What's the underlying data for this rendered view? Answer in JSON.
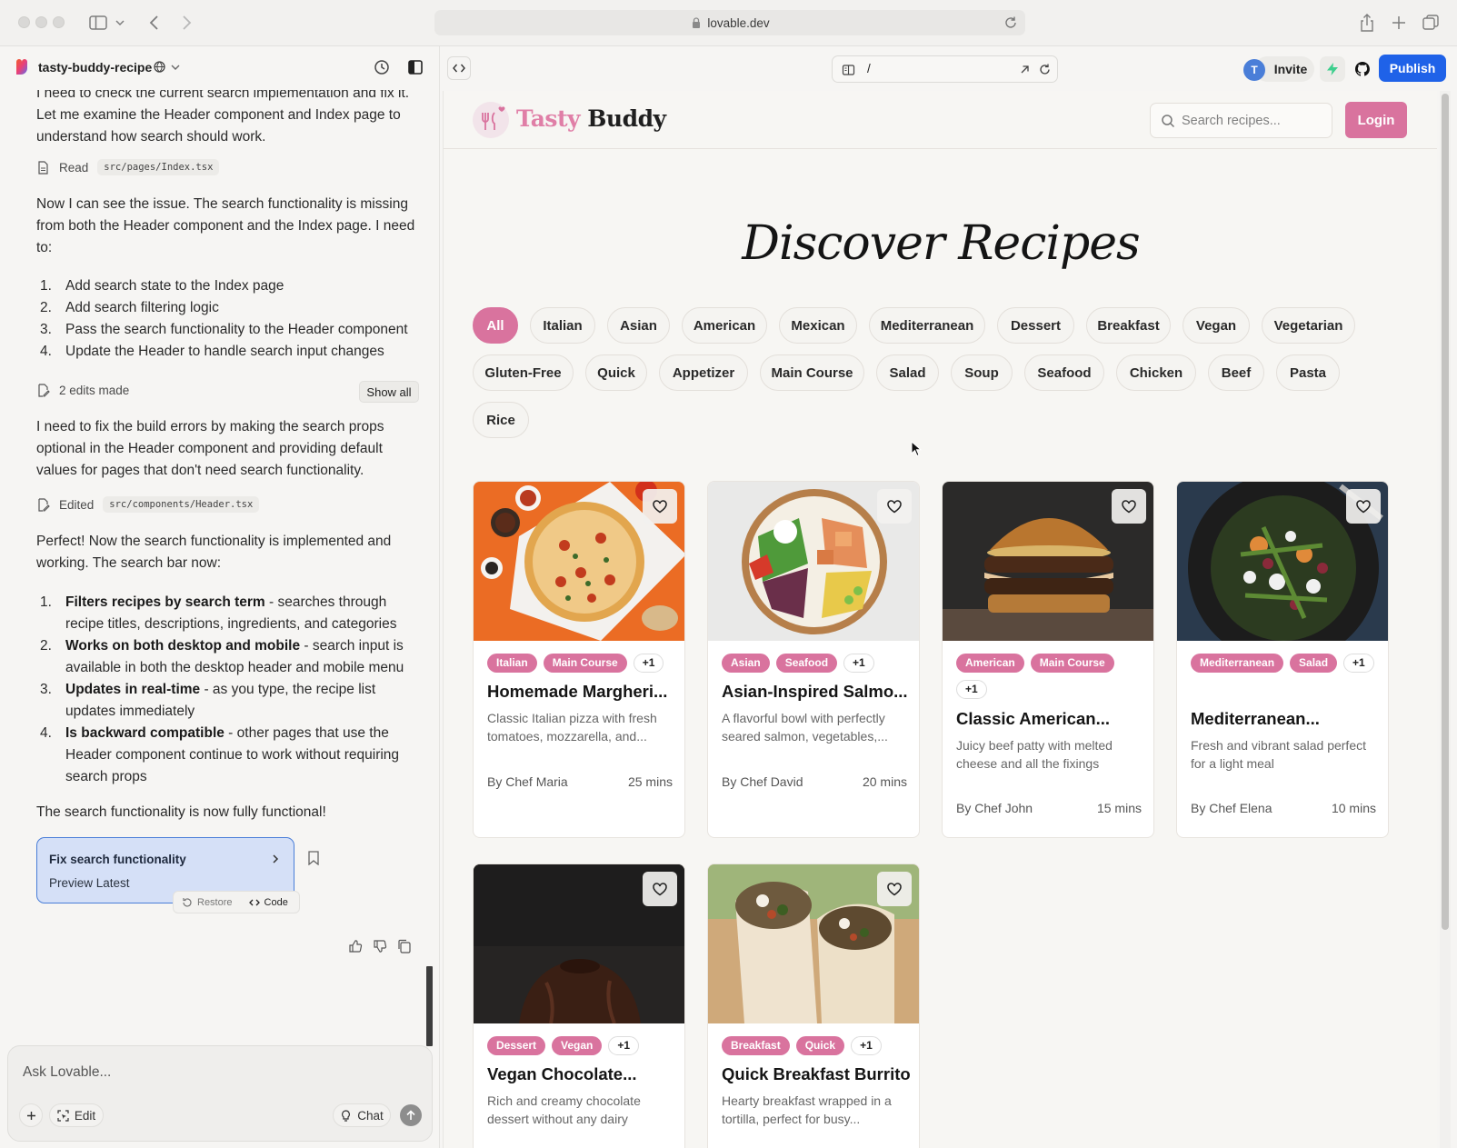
{
  "browser": {
    "url": "lovable.dev"
  },
  "project": {
    "name": "tasty-buddy-recipe"
  },
  "chat": {
    "intro_partial": "I need to check the current search implementation and fix it.",
    "intro_rest": "Let me examine the Header component and Index page to understand how search should work.",
    "read_label": "Read",
    "read_file": "src/pages/Index.tsx",
    "issue_text": "Now I can see the issue. The search functionality is missing from both the Header component and the Index page. I need to:",
    "steps": [
      "Add search state to the Index page",
      "Add search filtering logic",
      "Pass the search functionality to the Header component",
      "Update the Header to handle search input changes"
    ],
    "edits_label": "2 edits made",
    "show_all": "Show all",
    "build_text": "I need to fix the build errors by making the search props optional in the Header component and providing default values for pages that don't need search functionality.",
    "edited_label": "Edited",
    "edited_file": "src/components/Header.tsx",
    "perfect_text": "Perfect! Now the search functionality is implemented and working. The search bar now:",
    "features": [
      {
        "bold": "Filters recipes by search term",
        "rest": " - searches through recipe titles, descriptions, ingredients, and categories"
      },
      {
        "bold": "Works on both desktop and mobile",
        "rest": " - search input is available in both the desktop header and mobile menu"
      },
      {
        "bold": "Updates in real-time",
        "rest": " - as you type, the recipe list updates immediately"
      },
      {
        "bold": "Is backward compatible",
        "rest": " - other pages that use the Header component continue to work without requiring search props"
      }
    ],
    "final_text": "The search functionality is now fully functional!",
    "commit_title": "Fix search functionality",
    "commit_sub": "Preview Latest",
    "restore_label": "Restore",
    "code_label": "Code"
  },
  "composer": {
    "placeholder": "Ask Lovable...",
    "edit_label": "Edit",
    "chat_label": "Chat"
  },
  "preview": {
    "route": "/",
    "avatar_letter": "T",
    "invite_label": "Invite",
    "publish_label": "Publish"
  },
  "site": {
    "logo_part1": "Tasty",
    "logo_part2": "Buddy",
    "search_placeholder": "Search recipes...",
    "login_label": "Login",
    "hero_title": "Discover Recipes",
    "categories": [
      "All",
      "Italian",
      "Asian",
      "American",
      "Mexican",
      "Mediterranean",
      "Dessert",
      "Breakfast",
      "Vegan",
      "Vegetarian",
      "Gluten-Free",
      "Quick",
      "Appetizer",
      "Main Course",
      "Salad",
      "Soup",
      "Seafood",
      "Chicken",
      "Beef",
      "Pasta",
      "Rice"
    ],
    "active_category": "All",
    "brand_color": "#d9739e",
    "recipes": [
      {
        "tags": [
          "Italian",
          "Main Course"
        ],
        "more": "+1",
        "title": "Homemade Margheri...",
        "desc": "Classic Italian pizza with fresh tomatoes, mozzarella, and...",
        "chef": "By Chef Maria",
        "time": "25 mins",
        "image": "pizza"
      },
      {
        "tags": [
          "Asian",
          "Seafood"
        ],
        "more": "+1",
        "title": "Asian-Inspired Salmo...",
        "desc": "A flavorful bowl with perfectly seared salmon, vegetables,...",
        "chef": "By Chef David",
        "time": "20 mins",
        "image": "salmon-bowl"
      },
      {
        "tags": [
          "American",
          "Main Course"
        ],
        "more": "+1",
        "title": "Classic American...",
        "desc": "Juicy beef patty with melted cheese and all the fixings",
        "chef": "By Chef John",
        "time": "15 mins",
        "image": "burger"
      },
      {
        "tags": [
          "Mediterranean",
          "Salad"
        ],
        "more": "+1",
        "title": "Mediterranean...",
        "desc": "Fresh and vibrant salad perfect for a light meal",
        "chef": "By Chef Elena",
        "time": "10 mins",
        "image": "salad"
      },
      {
        "tags": [
          "Dessert",
          "Vegan"
        ],
        "more": "+1",
        "title": "Vegan Chocolate...",
        "desc": "Rich and creamy chocolate dessert without any dairy",
        "chef": "",
        "time": "",
        "image": "chocolate-cake"
      },
      {
        "tags": [
          "Breakfast",
          "Quick"
        ],
        "more": "+1",
        "title": "Quick Breakfast Burrito",
        "desc": "Hearty breakfast wrapped in a tortilla, perfect for busy...",
        "chef": "",
        "time": "",
        "image": "burrito"
      }
    ]
  }
}
